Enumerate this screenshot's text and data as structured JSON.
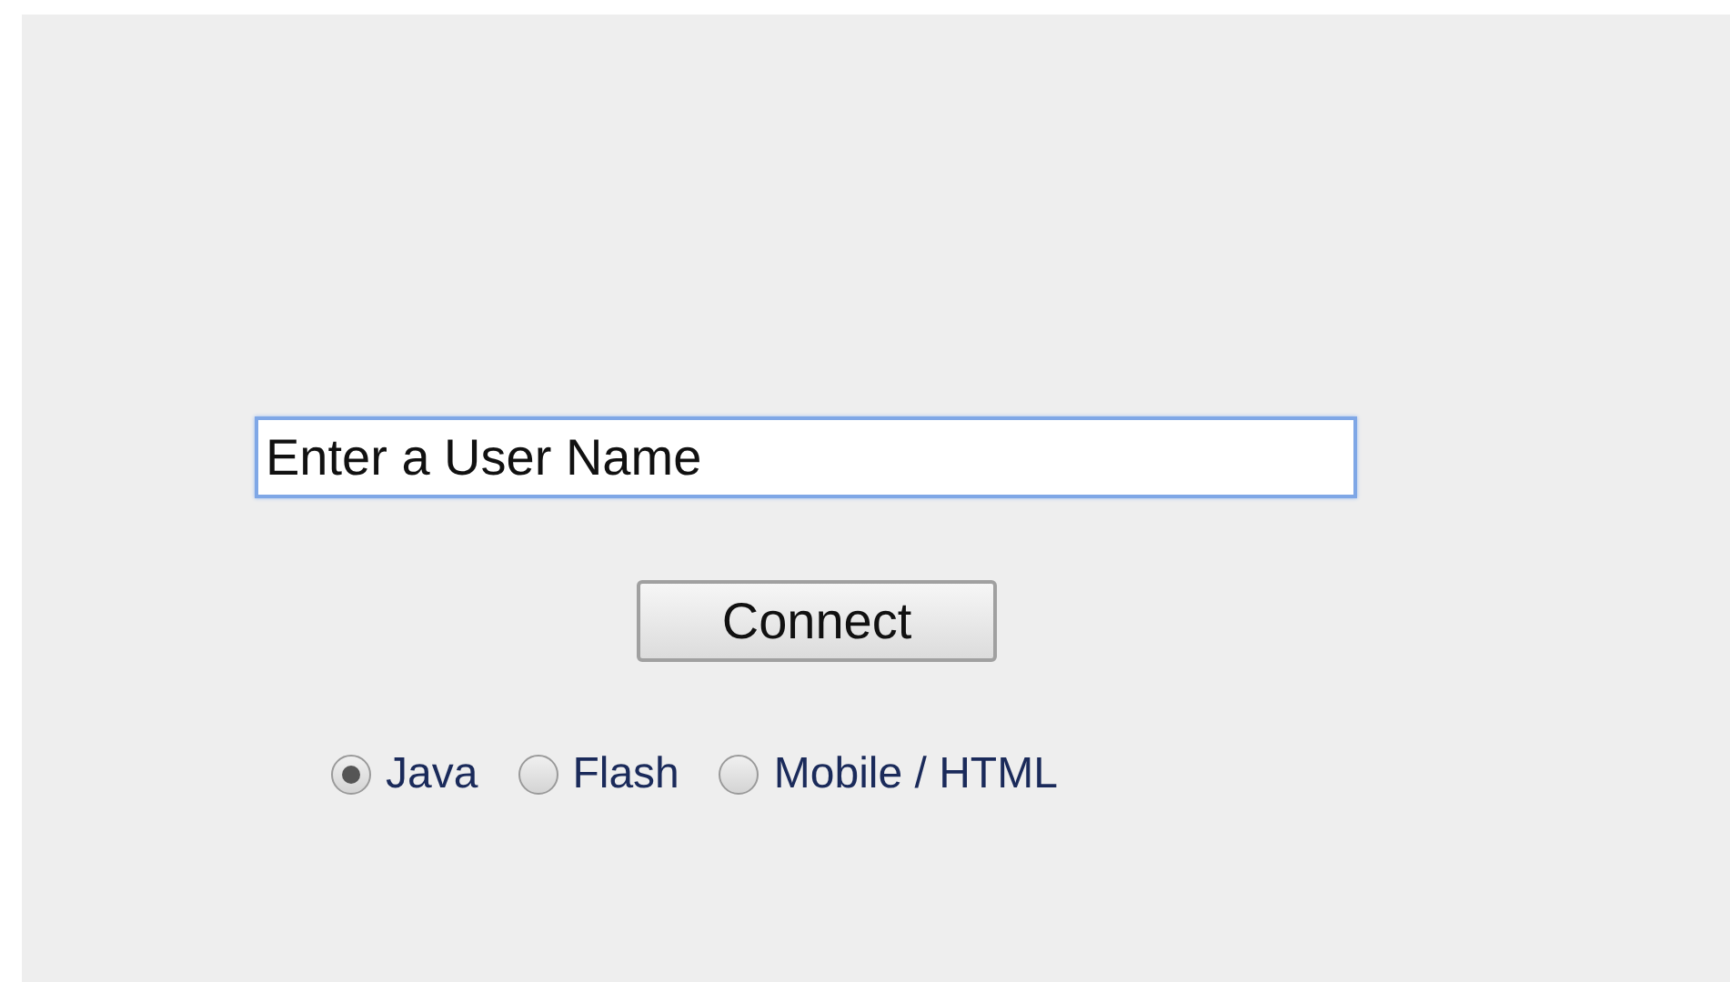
{
  "username_field": {
    "value": "Enter a User Name",
    "focused": true
  },
  "connect_button": {
    "label": "Connect"
  },
  "client_options": [
    {
      "label": "Java",
      "selected": true
    },
    {
      "label": "Flash",
      "selected": false
    },
    {
      "label": "Mobile / HTML",
      "selected": false
    }
  ]
}
